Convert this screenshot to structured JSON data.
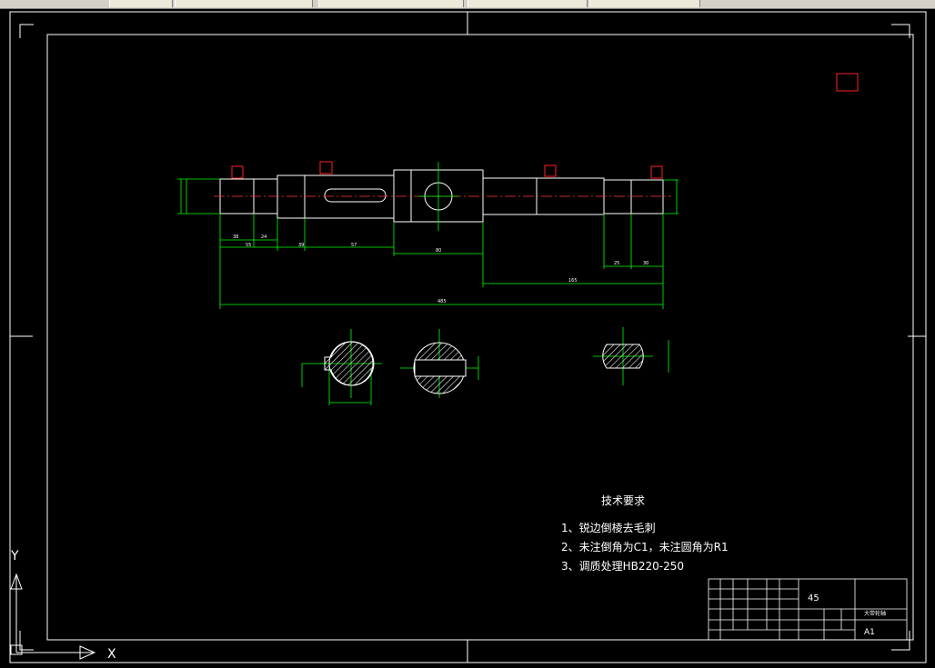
{
  "tabs": [
    "",
    "",
    "",
    "",
    ""
  ],
  "drawing": {
    "dimensions": {
      "d1": "38",
      "d2": "24",
      "d3": "55",
      "d4": "39",
      "d5": "57",
      "d6": "80",
      "d7": "165",
      "d8": "25",
      "d9": "30",
      "d10": "485"
    },
    "tech_title": "技术要求",
    "tech_items": [
      "1、锐边倒棱去毛刺",
      "2、未注倒角为C1，未注圆角为R1",
      "3、调质处理HB220-250"
    ],
    "title_block": {
      "material": "45",
      "part_name": "大带轮轴",
      "sheet_size": "A1"
    },
    "ucs": {
      "y": "Y",
      "x": "X"
    }
  },
  "colors": {
    "frame": "#ffffff",
    "part": "#ffffff",
    "dimension": "#00ff00",
    "centerline": "#ff3b3b",
    "marker": "#ff2020",
    "background": "#000000"
  }
}
